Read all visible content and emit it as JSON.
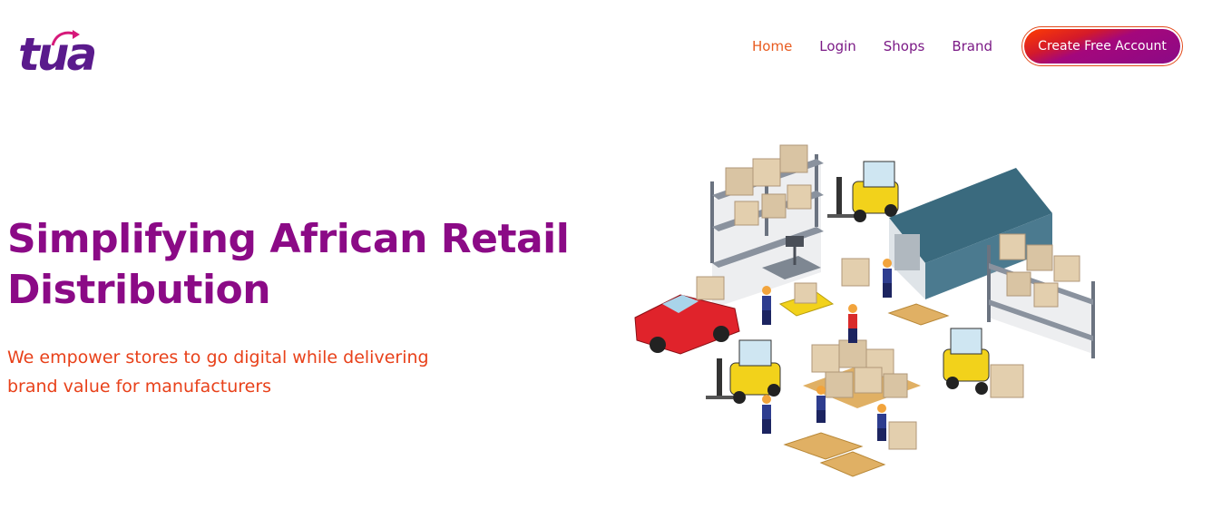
{
  "brand": {
    "logo_text": "tua",
    "primary_color": "#8b0a86",
    "accent_color": "#e8411a"
  },
  "nav": {
    "items": [
      {
        "label": "Home",
        "active": true
      },
      {
        "label": "Login",
        "active": false
      },
      {
        "label": "Shops",
        "active": false
      },
      {
        "label": "Brand",
        "active": false
      }
    ],
    "cta_label": "Create Free Account"
  },
  "hero": {
    "title_line1": "Simplifying African Retail",
    "title_line2": "Distribution",
    "subtitle_line1": "We empower stores to go digital while delivering",
    "subtitle_line2": "brand value for manufacturers"
  },
  "illustration": {
    "icon": "warehouse-logistics-illustration"
  }
}
